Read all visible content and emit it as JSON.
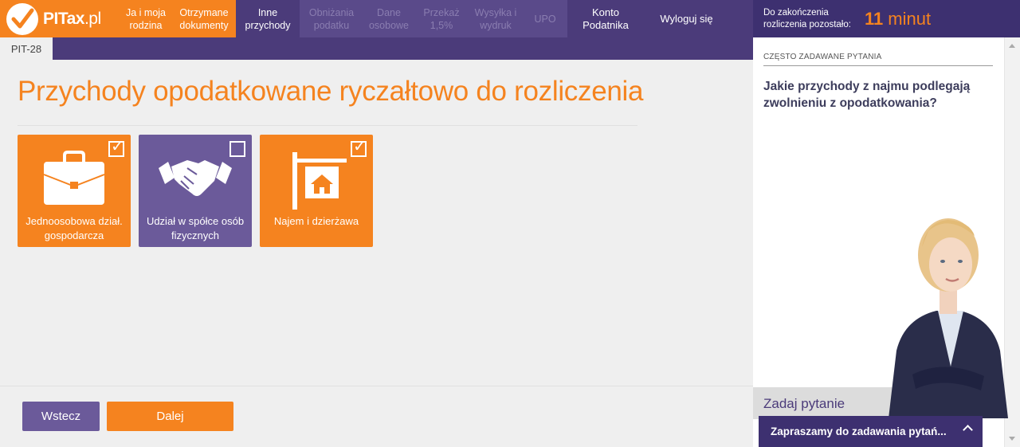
{
  "brand": {
    "logo_main": "PITax",
    "logo_suffix": ".pl"
  },
  "steps": [
    {
      "label": "Ja i moja rodzina",
      "state": "done"
    },
    {
      "label": "Otrzymane dokumenty",
      "state": "done"
    },
    {
      "label": "Inne przychody",
      "state": "active"
    },
    {
      "label": "Obniżania podatku",
      "state": "todo"
    },
    {
      "label": "Dane osobowe",
      "state": "todo"
    },
    {
      "label": "Przekaż 1,5%",
      "state": "todo"
    },
    {
      "label": "Wysyłka i wydruk",
      "state": "todo"
    },
    {
      "label": "UPO",
      "state": "todo"
    }
  ],
  "nav": {
    "account": "Konto Podatnika",
    "logout": "Wyloguj się"
  },
  "timer": {
    "label": "Do zakończenia rozliczenia pozostało:",
    "value": "11",
    "unit": "minut"
  },
  "form_tab": "PIT-28",
  "page_title": "Przychody opodatkowane ryczałtowo do rozliczenia",
  "tiles": [
    {
      "label": "Jednoosobowa dział. gospodarcza",
      "checked": true,
      "icon": "briefcase-icon"
    },
    {
      "label": "Udział w spółce osób fizycznych",
      "checked": false,
      "icon": "handshake-icon"
    },
    {
      "label": "Najem i dzierżawa",
      "checked": true,
      "icon": "house-sign-icon"
    }
  ],
  "buttons": {
    "back": "Wstecz",
    "next": "Dalej"
  },
  "faq": {
    "heading": "CZĘSTO ZADAWANE PYTANIA",
    "question": "Jakie przychody z najmu podlegają zwolnieniu z opodatkowania?"
  },
  "ask": {
    "label": "Zadaj pytanie",
    "invite": "Zapraszamy do zadawania pytań..."
  },
  "colors": {
    "orange": "#f5831f",
    "purple": "#4b3b7a",
    "tile_purple": "#6b5a9a"
  }
}
